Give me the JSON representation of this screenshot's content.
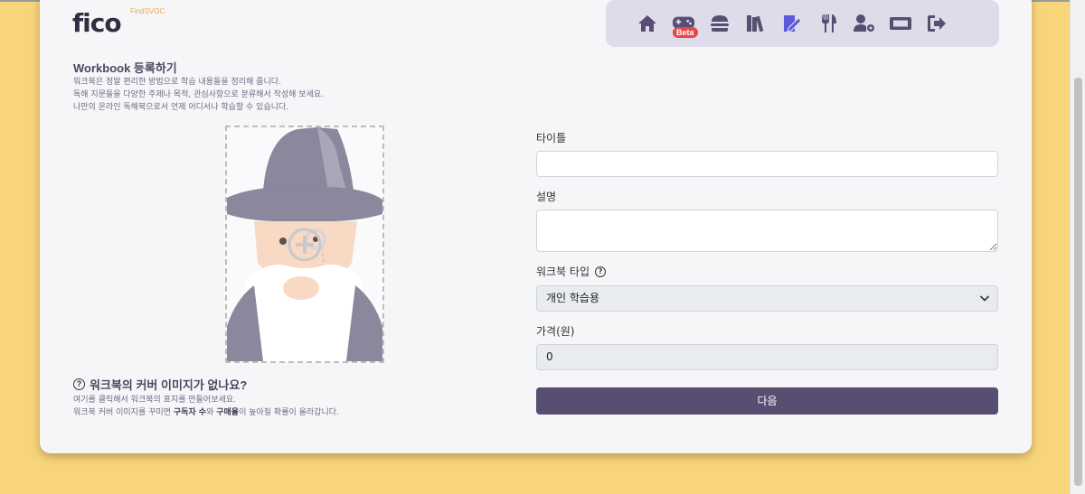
{
  "logo": {
    "text": "fico",
    "sub": "FindSVOC"
  },
  "nav": {
    "items": [
      {
        "icon": "home-icon"
      },
      {
        "icon": "gamepad-icon",
        "badge": "Beta"
      },
      {
        "icon": "burger-icon"
      },
      {
        "icon": "books-icon"
      },
      {
        "icon": "edit-book-icon"
      },
      {
        "icon": "utensils-icon"
      },
      {
        "icon": "user-gear-icon"
      },
      {
        "icon": "ticket-icon"
      },
      {
        "icon": "logout-icon"
      }
    ],
    "active_color": "#574e71",
    "accent_color": "#5a5adb"
  },
  "page": {
    "title": "Workbook 등록하기",
    "desc_lines": [
      "워크북은 정말 편리한 방법으로 학습 내용들을 정리해 줍니다.",
      "독해 지문들을 다양한 주제나 목적, 관심사항으로 분류해서 작성해 보세요.",
      "나만의 온라인 독해북으로서 언제 어디서나 학습할 수 있습니다."
    ]
  },
  "cover": {
    "question": "워크북의 커버 이미지가 없나요?",
    "desc_line1": "여기를 클릭해서 워크북의 표지를 만들어보세요.",
    "desc_line2_pre": "워크북 커버 이미지를 꾸미면 ",
    "desc_line2_b1": "구독자 수",
    "desc_line2_mid": "와 ",
    "desc_line2_b2": "구매율",
    "desc_line2_post": "이 높아질 확률이 올라갑니다."
  },
  "form": {
    "title_label": "타이틀",
    "title_value": "",
    "desc_label": "설명",
    "desc_value": "",
    "type_label": "워크북 타입",
    "type_value": "개인 학습용",
    "price_label": "가격(원)",
    "price_value": "0",
    "next_label": "다음"
  },
  "colors": {
    "background": "#f9d57a",
    "card": "#f6f6f9",
    "nav_bg": "#dedbeb",
    "button": "#574e71",
    "badge": "#e6474a"
  }
}
